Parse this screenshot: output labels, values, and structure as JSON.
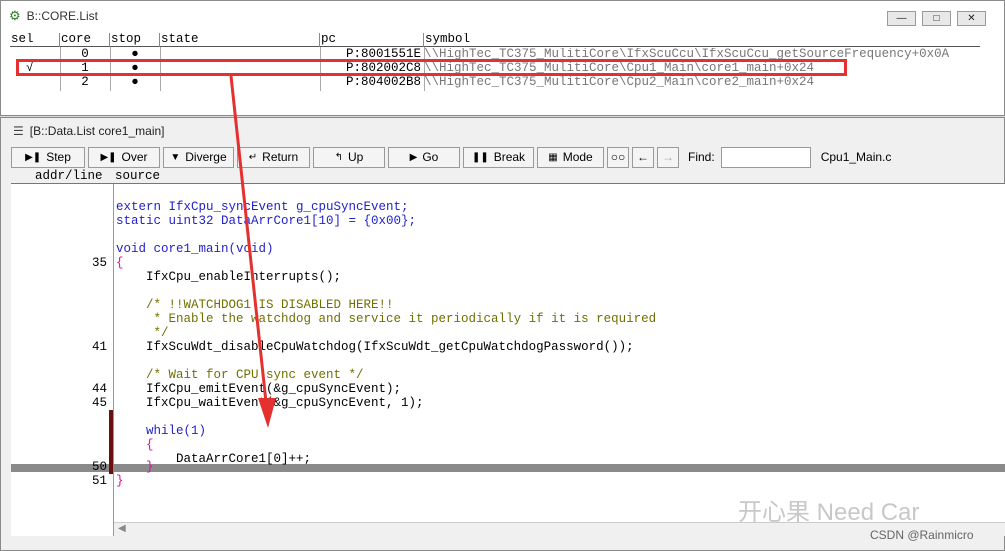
{
  "core_window": {
    "title": "B::CORE.List",
    "controls": {
      "minimize": "—",
      "maximize": "□",
      "close": "✕"
    },
    "columns": [
      "sel",
      "core",
      "stop",
      "state",
      "pc",
      "symbol"
    ],
    "rows": [
      {
        "sel": "",
        "core": "0",
        "stop": "●",
        "state": "",
        "pc": "P:8001551E",
        "symbol": "\\\\HighTec_TC375_MulitiCore\\IfxScuCcu\\IfxScuCcu_getSourceFrequency+0x0A"
      },
      {
        "sel": "√",
        "core": "1",
        "stop": "●",
        "state": "",
        "pc": "P:802002C8",
        "symbol": "\\\\HighTec_TC375_MulitiCore\\Cpu1_Main\\core1_main+0x24"
      },
      {
        "sel": "",
        "core": "2",
        "stop": "●",
        "state": "",
        "pc": "P:804002B8",
        "symbol": "\\\\HighTec_TC375_MulitiCore\\Cpu2_Main\\core2_main+0x24"
      }
    ]
  },
  "data_window": {
    "title": "[B::Data.List core1_main]",
    "toolbar": {
      "step": "Step",
      "over": "Over",
      "diverge": "Diverge",
      "return": "Return",
      "up": "Up",
      "go": "Go",
      "break": "Break",
      "mode": "Mode",
      "find_label": "Find:",
      "find_value": "",
      "file": "Cpu1_Main.c"
    },
    "columns": {
      "addr": "addr/line",
      "source": "source"
    },
    "lines": [
      {
        "ln": "",
        "text": ""
      },
      {
        "ln": "",
        "text": "extern IfxCpu_syncEvent g_cpuSyncEvent;"
      },
      {
        "ln": "",
        "text": "static uint32 DataArrCore1[10] = {0x00};"
      },
      {
        "ln": "",
        "text": ""
      },
      {
        "ln": "",
        "text": "void core1_main(void)"
      },
      {
        "ln": "35",
        "text": "{"
      },
      {
        "ln": "",
        "text": "    IfxCpu_enableInterrupts();"
      },
      {
        "ln": "",
        "text": ""
      },
      {
        "ln": "",
        "text": "    /* !!WATCHDOG1 IS DISABLED HERE!!"
      },
      {
        "ln": "",
        "text": "     * Enable the watchdog and service it periodically if it is required"
      },
      {
        "ln": "",
        "text": "     */"
      },
      {
        "ln": "41",
        "text": "    IfxScuWdt_disableCpuWatchdog(IfxScuWdt_getCpuWatchdogPassword());"
      },
      {
        "ln": "",
        "text": ""
      },
      {
        "ln": "",
        "text": "    /* Wait for CPU sync event */"
      },
      {
        "ln": "44",
        "text": "    IfxCpu_emitEvent(&g_cpuSyncEvent);"
      },
      {
        "ln": "45",
        "text": "    IfxCpu_waitEvent(&g_cpuSyncEvent, 1);"
      },
      {
        "ln": "",
        "text": ""
      },
      {
        "ln": "",
        "text": "    while(1)"
      },
      {
        "ln": "",
        "text": "    {"
      },
      {
        "ln": "",
        "text": "        DataArrCore1[0]++;"
      },
      {
        "ln": "50",
        "text": "    }"
      },
      {
        "ln": "51",
        "text": "}"
      }
    ]
  },
  "watermark": {
    "brand": "开心果 Need Car",
    "credit": "CSDN @Rainmicro"
  },
  "colors": {
    "highlight_box": "#e53030",
    "arrow": "#e53030",
    "keyword": "#2222cc",
    "brace": "#d010a0",
    "comment": "#707000"
  }
}
